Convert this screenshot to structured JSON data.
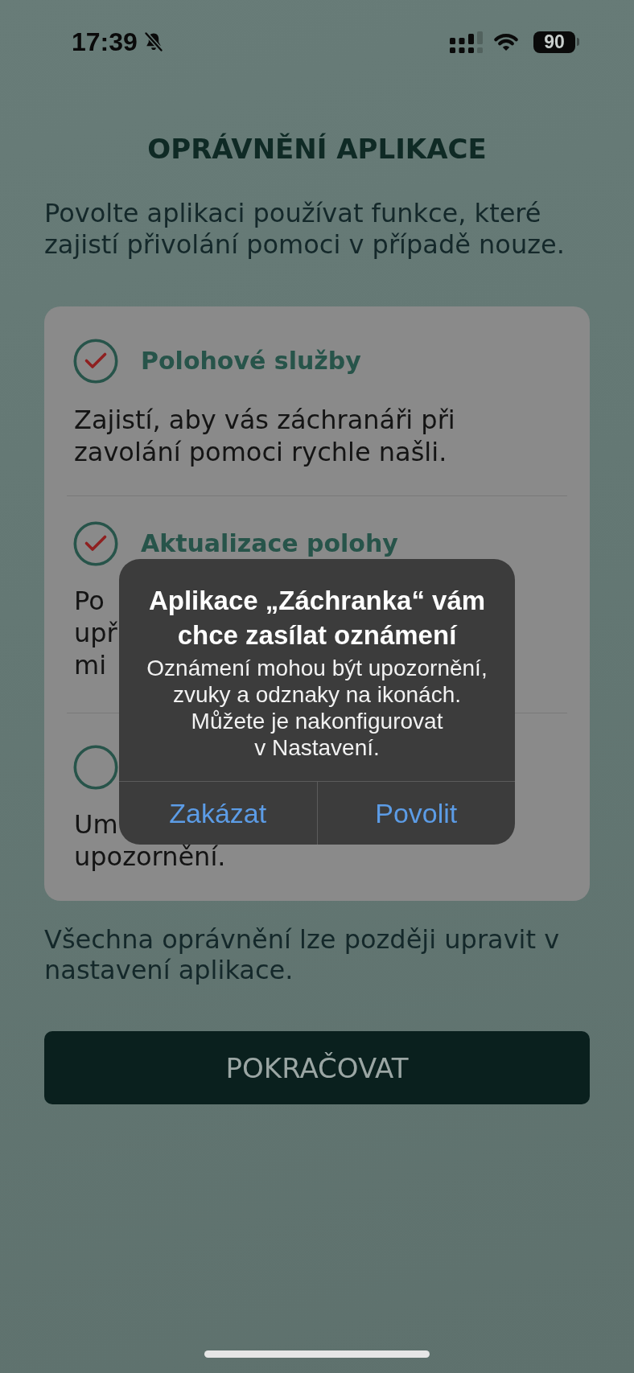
{
  "status_bar": {
    "time": "17:39",
    "silent": true,
    "battery": "90"
  },
  "screen": {
    "title": "OPRÁVNĚNÍ APLIKACE",
    "intro": "Povolte aplikaci používat funkce, které zajistí přivolání pomoci v případě nouze."
  },
  "permissions": [
    {
      "title": "Polohové služby",
      "checked": true,
      "description": "Zajistí, aby vás záchranáři při zavolání pomoci rychle našli."
    },
    {
      "title": "Aktualizace polohy",
      "checked": true,
      "description_fragments": [
        "Po",
        "upř",
        "mi"
      ]
    },
    {
      "checked": false,
      "description_fragments": [
        "Um",
        "upozornění."
      ]
    }
  ],
  "settings_note": "Všechna oprávnění lze později upravit v nastavení aplikace.",
  "continue_button": {
    "label": "POKRAČOVAT"
  },
  "alert": {
    "title": "Aplikace „Záchranka“ vám chce zasílat oznámení",
    "message": "Oznámení mohou být upozornění, zvuky a odznaky na ikonách. Můžete je nakonfigurovat v Nastavení.",
    "buttons": [
      {
        "label": "Zakázat"
      },
      {
        "label": "Povolit"
      }
    ]
  }
}
